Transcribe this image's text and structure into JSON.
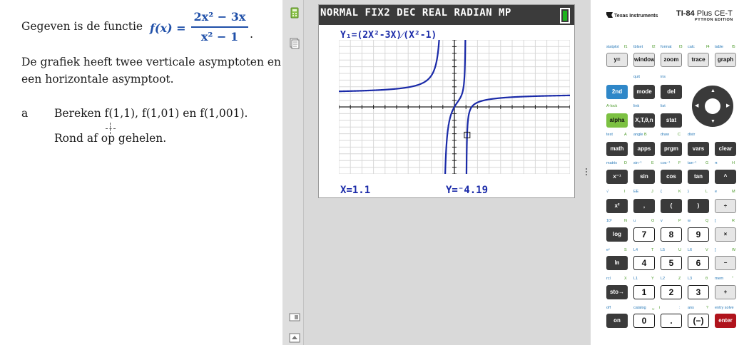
{
  "doc": {
    "intro": "Gegeven is de functie",
    "formula_lhs": "f(x) =",
    "formula_num": "2x² − 3x",
    "formula_den": "x² − 1",
    "formula_end": ".",
    "desc_line1": "De grafiek heeft twee verticale asymptoten en",
    "desc_line2": "een horizontale asymptoot.",
    "question_letter": "a",
    "question_line1": "Bereken f(1,1), f(1,01) en f(1,001).",
    "question_line2": "Rond af op gehelen."
  },
  "sidebar": {
    "icons": [
      "calculator-icon",
      "document-icon",
      "layout-icon",
      "scroll-up-icon"
    ]
  },
  "screen": {
    "status": "NORMAL FIX2 DEC REAL RADIAN MP",
    "equation": "Y₁=(2X²-3X)⁄(X²-1)",
    "x_readout": "X=1.1",
    "y_readout": "Y=⁻4.19",
    "colors": {
      "curve": "#1a2aa8",
      "status_bg": "#3b3b3b",
      "battery": "#1db31d"
    }
  },
  "graph_data": {
    "function": "(2x^2-3x)/(x^2-1)",
    "xlim": [
      -10,
      10
    ],
    "ylim": [
      -10,
      10
    ],
    "grid": true,
    "trace_x": 1.1
  },
  "keypad": {
    "brand": "Texas Instruments",
    "model": "TI-84",
    "model_plus": "Plus CE-T",
    "edition": "PYTHON EDITION",
    "labels": {
      "r0": [
        "statplot",
        "f1",
        "tblset",
        "f2",
        "format",
        "f3",
        "calc",
        "f4",
        "table",
        "f5"
      ],
      "r1": [
        "quit",
        "ins"
      ],
      "r2": [
        "A-lock",
        "link",
        "list"
      ],
      "r3": [
        "test",
        "A",
        "angle",
        "B",
        "draw",
        "C",
        "distr"
      ],
      "r4": [
        "matrix",
        "D",
        "sin⁻¹",
        "E",
        "cos⁻¹",
        "F",
        "tan⁻¹",
        "G",
        "π",
        "H"
      ],
      "r5": [
        "√",
        "I",
        "EE",
        "J",
        "{",
        "K",
        "}",
        "L",
        "e",
        "M"
      ],
      "r6": [
        "10ˣ",
        "N",
        "u",
        "O",
        "v",
        "P",
        "w",
        "Q",
        "[",
        "R"
      ],
      "r7": [
        "eˣ",
        "S",
        "L4",
        "T",
        "L5",
        "U",
        "L6",
        "V",
        "]",
        "W"
      ],
      "r8": [
        "rcl",
        "X",
        "L1",
        "Y",
        "L2",
        "Z",
        "L3",
        "θ",
        "mem",
        "\""
      ],
      "r9": [
        "off",
        "catalog",
        "␣",
        "i",
        ":",
        "ans",
        "?",
        "entry solve"
      ]
    },
    "keys": {
      "y": "y=",
      "window": "window",
      "zoom": "zoom",
      "trace": "trace",
      "graph": "graph",
      "second": "2nd",
      "mode": "mode",
      "del": "del",
      "alpha": "alpha",
      "xt": "X,T,θ,n",
      "stat": "stat",
      "math": "math",
      "apps": "apps",
      "prgm": "prgm",
      "vars": "vars",
      "clear": "clear",
      "inv": "x⁻¹",
      "sin": "sin",
      "cos": "cos",
      "tan": "tan",
      "pow": "^",
      "sq": "x²",
      "comma": ",",
      "lp": "(",
      "rp": ")",
      "div": "÷",
      "log": "log",
      "k7": "7",
      "k8": "8",
      "k9": "9",
      "mul": "×",
      "ln": "ln",
      "k4": "4",
      "k5": "5",
      "k6": "6",
      "sub": "−",
      "sto": "sto→",
      "k1": "1",
      "k2": "2",
      "k3": "3",
      "add": "+",
      "on": "on",
      "k0": "0",
      "dot": ".",
      "neg": "(−)",
      "enter": "enter"
    }
  }
}
